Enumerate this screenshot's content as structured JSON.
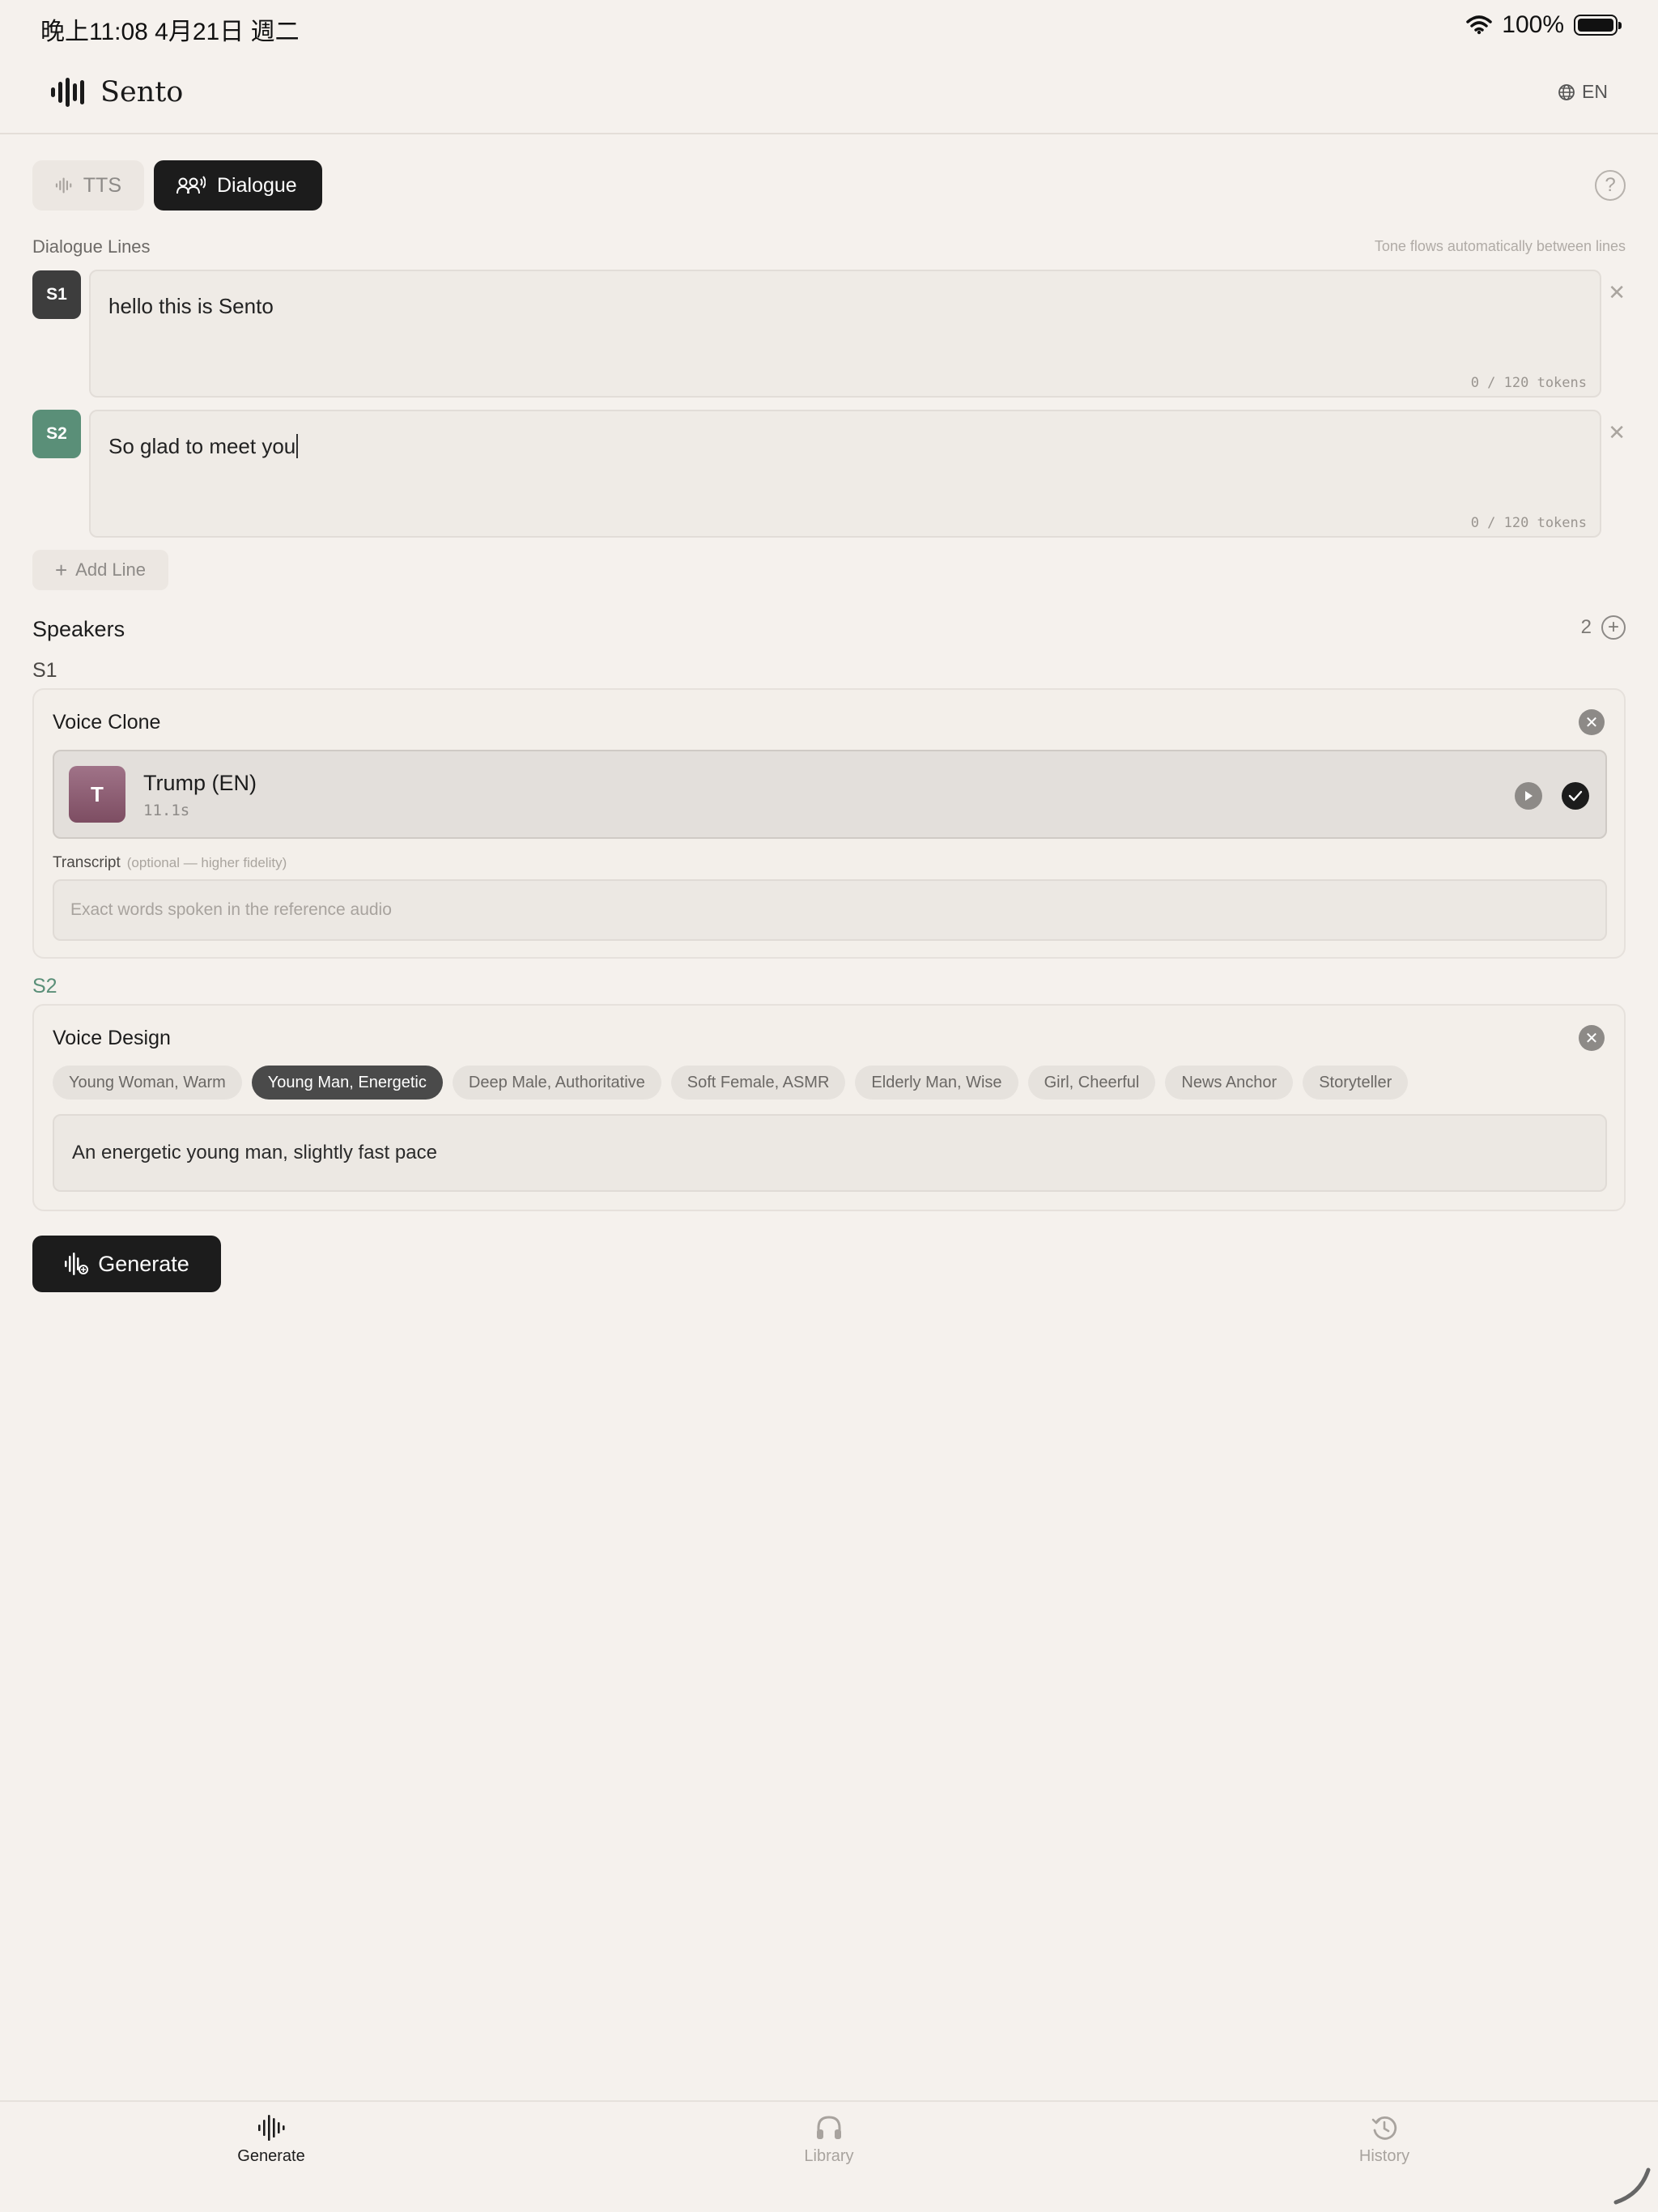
{
  "status": {
    "time": "晚上11:08 4月21日 週二",
    "battery": "100%"
  },
  "header": {
    "brand": "Sento",
    "language": "EN"
  },
  "tabs": [
    {
      "label": "TTS",
      "active": false
    },
    {
      "label": "Dialogue",
      "active": true
    }
  ],
  "dialogue": {
    "label": "Dialogue Lines",
    "hint": "Tone flows automatically between lines",
    "lines": [
      {
        "speaker": "S1",
        "text": "hello this is Sento",
        "tokens": "0 / 120 tokens",
        "color": "#3d3d3d"
      },
      {
        "speaker": "S2",
        "text": "So glad to meet you",
        "tokens": "0 / 120 tokens",
        "color": "#5a8f78"
      }
    ],
    "add_label": "Add Line"
  },
  "speakers": {
    "title": "Speakers",
    "count": "2",
    "s1": {
      "label": "S1",
      "mode": "Voice Clone",
      "voice": {
        "initial": "T",
        "name": "Trump (EN)",
        "duration": "11.1s"
      },
      "transcript_label": "Transcript",
      "transcript_hint": "(optional — higher fidelity)",
      "transcript_placeholder": "Exact words spoken in the reference audio"
    },
    "s2": {
      "label": "S2",
      "label_color": "#5a8f78",
      "mode": "Voice Design",
      "presets": [
        {
          "label": "Young Woman, Warm",
          "active": false
        },
        {
          "label": "Young Man, Energetic",
          "active": true
        },
        {
          "label": "Deep Male, Authoritative",
          "active": false
        },
        {
          "label": "Soft Female, ASMR",
          "active": false
        },
        {
          "label": "Elderly Man, Wise",
          "active": false
        },
        {
          "label": "Girl, Cheerful",
          "active": false
        },
        {
          "label": "News Anchor",
          "active": false
        },
        {
          "label": "Storyteller",
          "active": false
        }
      ],
      "description": "An energetic young man, slightly fast pace"
    }
  },
  "generate_label": "Generate",
  "nav": [
    {
      "label": "Generate",
      "icon": "waveform-icon",
      "active": true
    },
    {
      "label": "Library",
      "icon": "headphones-icon",
      "active": false
    },
    {
      "label": "History",
      "icon": "history-icon",
      "active": false
    }
  ]
}
